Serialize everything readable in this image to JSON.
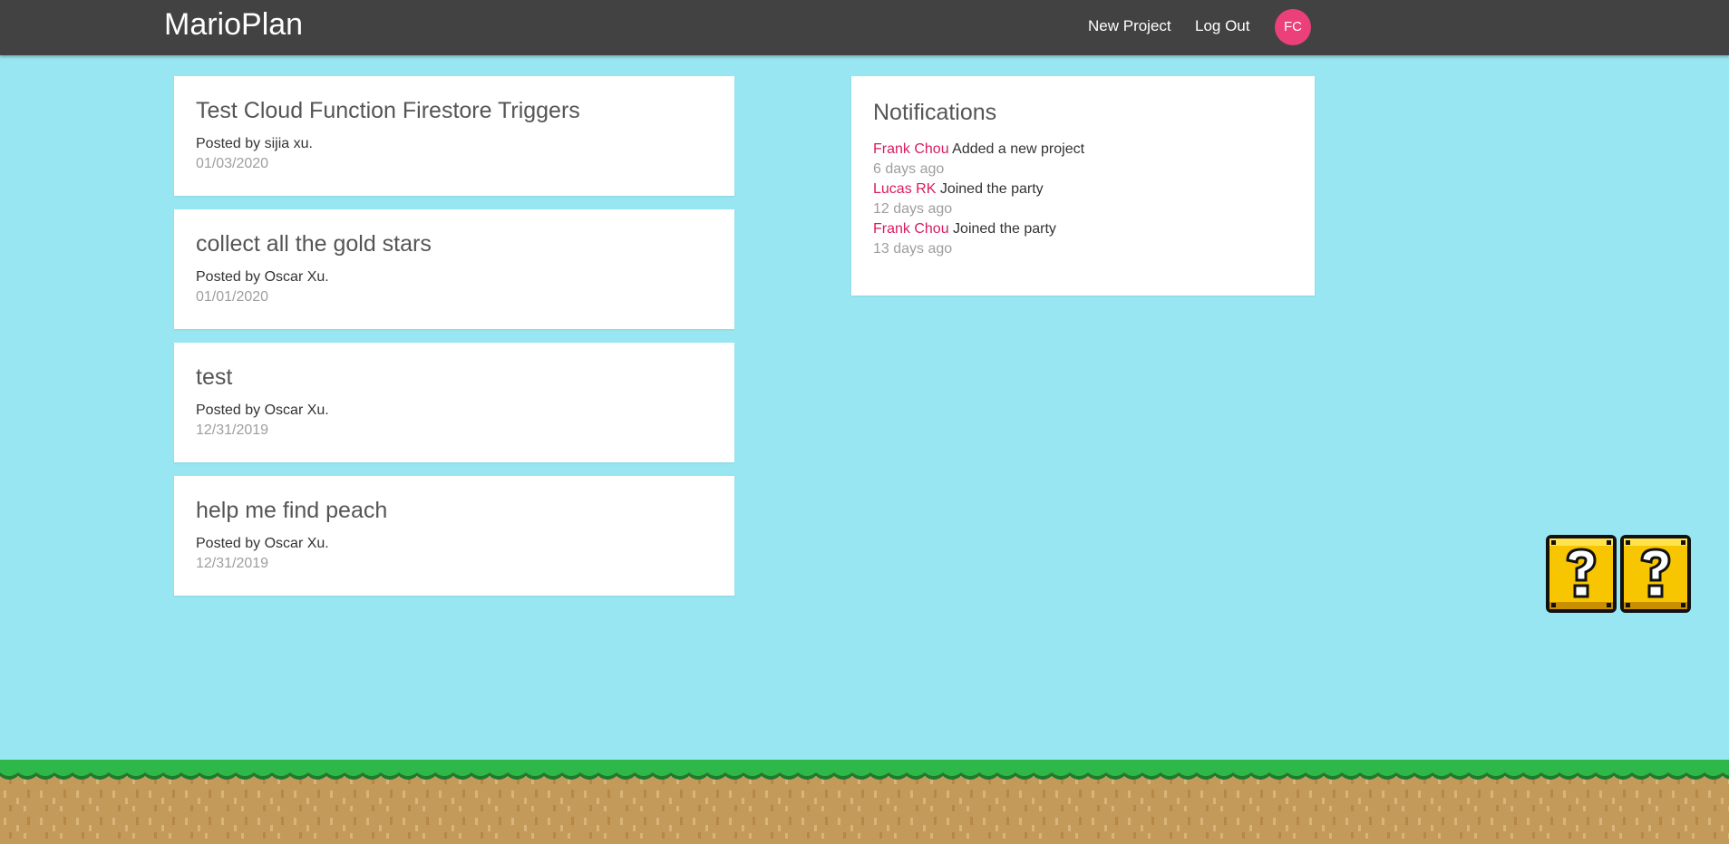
{
  "navbar": {
    "brand": "MarioPlan",
    "links": [
      "New Project",
      "Log Out"
    ],
    "avatar_initials": "FC",
    "avatar_color": "#ec407a",
    "background_color": "#424242"
  },
  "projects": [
    {
      "title": "Test Cloud Function Firestore Triggers",
      "author": "Posted by sijia xu.",
      "date": "01/03/2020"
    },
    {
      "title": "collect all the gold stars",
      "author": "Posted by Oscar Xu.",
      "date": "01/01/2020"
    },
    {
      "title": "test",
      "author": "Posted by Oscar Xu.",
      "date": "12/31/2019"
    },
    {
      "title": "help me find peach",
      "author": "Posted by Oscar Xu.",
      "date": "12/31/2019"
    }
  ],
  "notifications": {
    "title": "Notifications",
    "items": [
      {
        "user": "Frank Chou",
        "action": "Added a new project",
        "time": "6 days ago"
      },
      {
        "user": "Lucas RK",
        "action": "Joined the party",
        "time": "12 days ago"
      },
      {
        "user": "Frank Chou",
        "action": "Joined the party",
        "time": "13 days ago"
      }
    ]
  },
  "decorations": {
    "question_blocks_icon": "question-block-icon",
    "ground_icon": "grass-ground-icon",
    "sky_color": "#98e6f1"
  }
}
